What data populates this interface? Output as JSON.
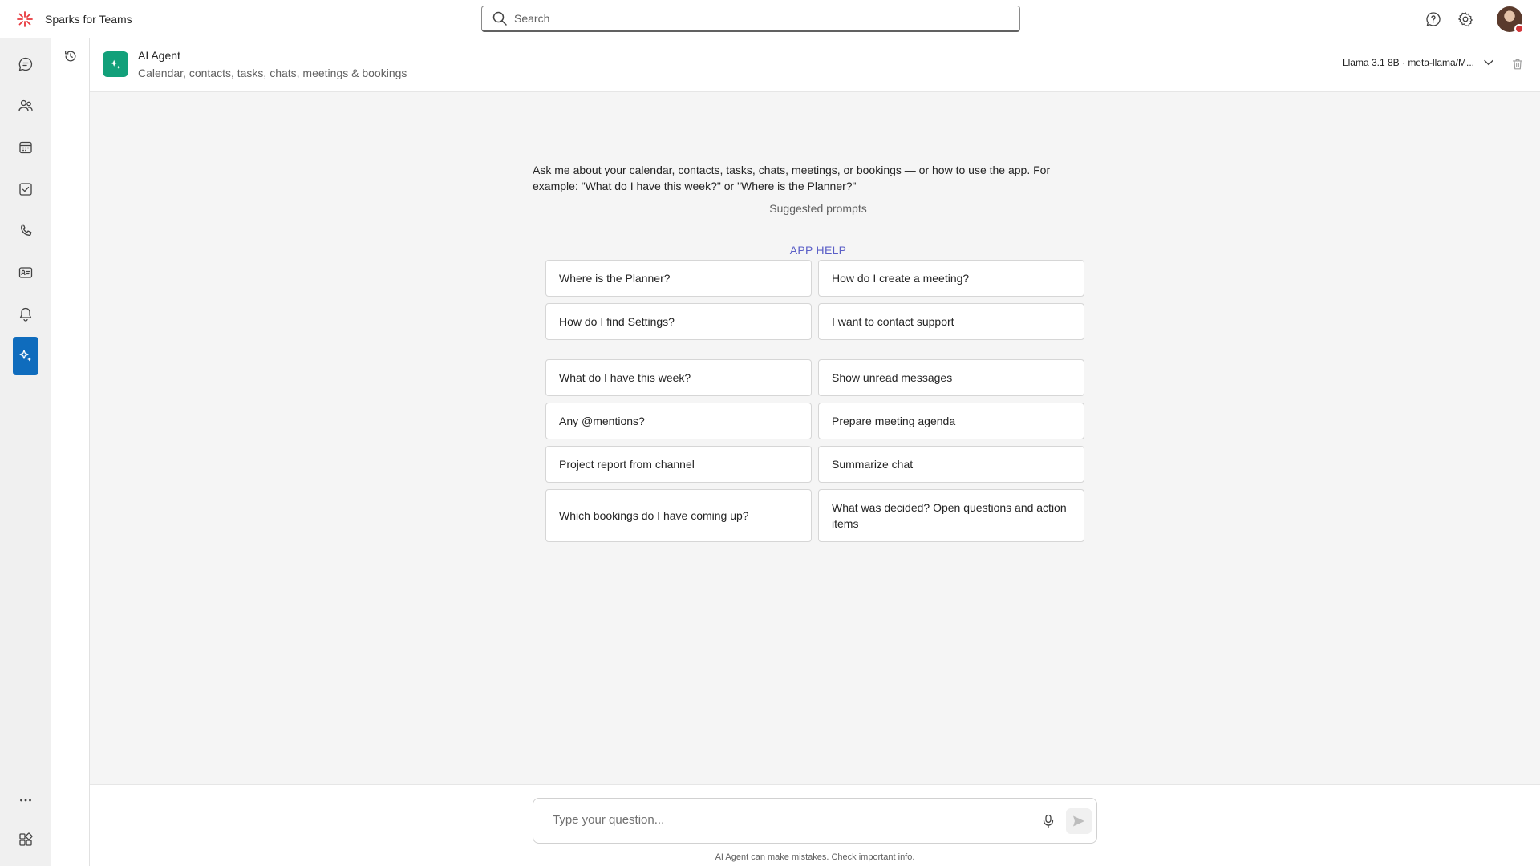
{
  "app": {
    "name": "Sparks for Teams",
    "logo_icon": "sparks-logo-icon",
    "brand_color": "#e8383d"
  },
  "search": {
    "placeholder": "Search"
  },
  "topbar": {
    "help_icon": "help-icon",
    "settings_icon": "gear-icon",
    "avatar_status_color": "#d13438"
  },
  "rail": {
    "items": [
      {
        "name": "chat",
        "icon": "chat-icon",
        "active": false
      },
      {
        "name": "teams",
        "icon": "people-icon",
        "active": false
      },
      {
        "name": "calendar",
        "icon": "calendar-icon",
        "active": false
      },
      {
        "name": "tasks",
        "icon": "tasks-icon",
        "active": false
      },
      {
        "name": "calls",
        "icon": "phone-icon",
        "active": false
      },
      {
        "name": "contacts",
        "icon": "contact-card-icon",
        "active": false
      },
      {
        "name": "activity",
        "icon": "bell-icon",
        "active": false
      },
      {
        "name": "ai-agent",
        "icon": "sparkle-icon",
        "active": true
      }
    ],
    "more_icon": "more-icon",
    "apps_icon": "apps-icon",
    "accent": "#0f6cbd"
  },
  "agent": {
    "title": "AI Agent",
    "subtitle": "Calendar, contacts, tasks, chats, meetings & bookings",
    "model": "Llama 3.1 8B · meta-llama/M...",
    "badge_color": "#12a07a"
  },
  "main": {
    "intro": "Ask me about your calendar, contacts, tasks, chats, meetings, or bookings — or how to use the app. For example: \"What do I have this week?\" or \"Where is the Planner?\"",
    "suggested_label": "Suggested prompts",
    "app_help_label": "APP HELP",
    "app_help_prompts": [
      "Where is the Planner?",
      "How do I create a meeting?",
      "How do I find Settings?",
      "I want to contact support"
    ],
    "prompts": [
      "What do I have this week?",
      "Show unread messages",
      "Any @mentions?",
      "Prepare meeting agenda",
      "Project report from channel",
      "Summarize chat",
      "Which bookings do I have coming up?",
      "What was decided? Open questions and action items"
    ]
  },
  "composer": {
    "placeholder": "Type your question...",
    "disclaimer": "AI Agent can make mistakes. Check important info."
  }
}
